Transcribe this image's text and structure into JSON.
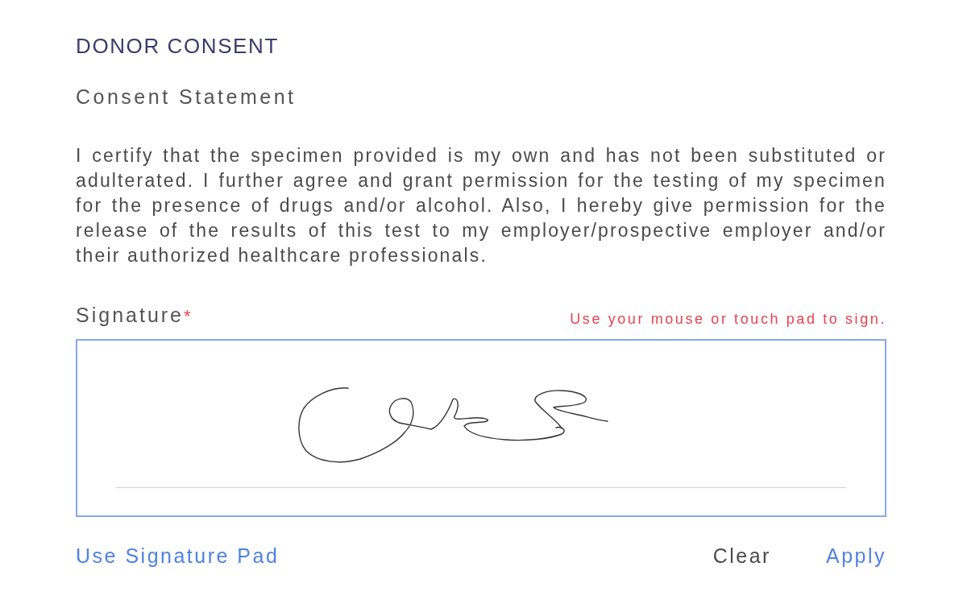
{
  "section": {
    "title": "DONOR CONSENT"
  },
  "statement": {
    "heading": "Consent Statement",
    "text": "I certify that the specimen provided is my own and has not been substituted or adulterated. I further agree and grant permission for the testing of my specimen for the presence of drugs and/or alcohol. Also, I hereby give permission for the release of the results of this test to my employer/prospective employer and/or their authorized healthcare professionals."
  },
  "signature": {
    "label": "Signature",
    "required_mark": "*",
    "hint": "Use your mouse or touch pad to sign.",
    "signed": true
  },
  "actions": {
    "left": [
      {
        "label": "Use Signature Pad",
        "kind": "link"
      }
    ],
    "right": [
      {
        "label": "Clear",
        "kind": "plain"
      },
      {
        "label": "Apply",
        "kind": "link"
      }
    ]
  }
}
